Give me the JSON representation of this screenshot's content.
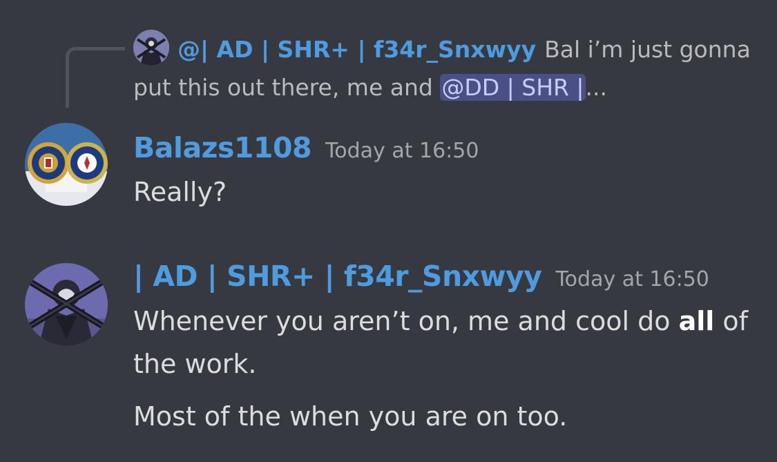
{
  "reply": {
    "author": "@| AD | SHR+ | f34r_Snxwyy",
    "text_before": "Bal i’m just gonna put this out there, me and ",
    "mention": "@DD | SHR |",
    "ellipsis": "..."
  },
  "messages": [
    {
      "author": "Balazs1108",
      "timestamp": "Today at 16:50",
      "lines": [
        {
          "text": "Really?"
        }
      ]
    },
    {
      "author": "| AD | SHR+ | f34r_Snxwyy",
      "timestamp": "Today at 16:50",
      "lines": [
        {
          "text_before": "Whenever you aren’t on, me and cool do ",
          "bold": "all",
          "text_after": " of the work."
        },
        {
          "text": "Most of the when you are on too."
        }
      ]
    }
  ],
  "colors": {
    "background": "#36393f",
    "username": "#4f9be0",
    "mention_bg": "#4a4f86",
    "message_text": "#dcddde",
    "timestamp": "#a3a6aa"
  },
  "icons": {
    "reply_avatar": "reaper-avatar-icon",
    "avatar_1": "fbi-cia-seal-avatar-icon",
    "avatar_2": "reaper-avatar-icon"
  }
}
